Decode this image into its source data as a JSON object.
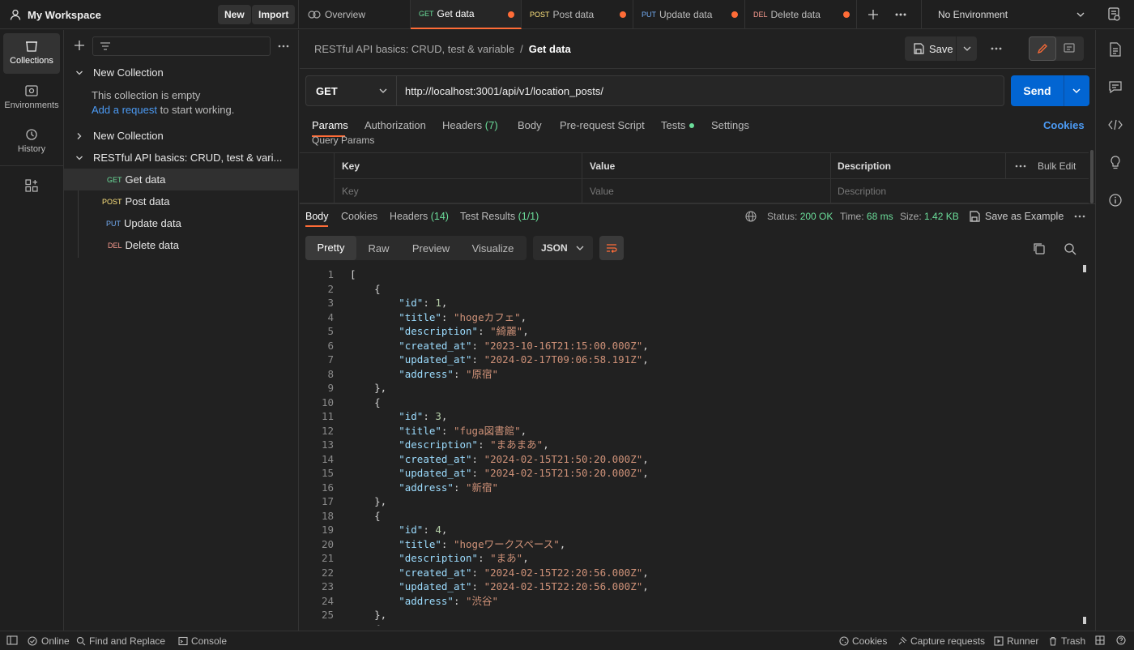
{
  "header": {
    "workspace_title": "My Workspace",
    "new_label": "New",
    "import_label": "Import",
    "tabs": [
      {
        "method": "",
        "label": "Overview"
      },
      {
        "method": "GET",
        "label": "Get data"
      },
      {
        "method": "POST",
        "label": "Post data"
      },
      {
        "method": "PUT",
        "label": "Update data"
      },
      {
        "method": "DEL",
        "label": "Delete data"
      }
    ],
    "environment": "No Environment"
  },
  "rail": {
    "items": [
      {
        "label": "Collections",
        "icon": "collections-icon"
      },
      {
        "label": "Environments",
        "icon": "environments-icon"
      },
      {
        "label": "History",
        "icon": "history-icon"
      },
      {
        "label": "",
        "icon": "add-panel-icon"
      }
    ]
  },
  "sidebar": {
    "collections": [
      {
        "name": "New Collection",
        "expanded": true
      },
      {
        "name": "New Collection",
        "expanded": false
      },
      {
        "name": "RESTful API basics: CRUD, test & vari...",
        "expanded": true
      }
    ],
    "empty_text": "This collection is empty",
    "add_request_link": "Add a request",
    "add_request_suffix": " to start working.",
    "requests": [
      {
        "method": "GET",
        "label": "Get data"
      },
      {
        "method": "POST",
        "label": "Post data"
      },
      {
        "method": "PUT",
        "label": "Update data"
      },
      {
        "method": "DEL",
        "label": "Delete data"
      }
    ]
  },
  "request": {
    "breadcrumb_collection": "RESTful API basics: CRUD, test & variable",
    "breadcrumb_separator": "/",
    "breadcrumb_current": "Get data",
    "save_label": "Save",
    "method": "GET",
    "url": "http://localhost:3001/api/v1/location_posts/",
    "send_label": "Send",
    "tabs": {
      "params": "Params",
      "authorization": "Authorization",
      "headers": "Headers",
      "headers_count": "(7)",
      "body": "Body",
      "prerequest": "Pre-request Script",
      "tests": "Tests",
      "settings": "Settings",
      "cookies": "Cookies"
    },
    "query_params_title": "Query Params",
    "table": {
      "key_header": "Key",
      "value_header": "Value",
      "description_header": "Description",
      "bulk_edit": "Bulk Edit",
      "key_placeholder": "Key",
      "value_placeholder": "Value",
      "description_placeholder": "Description"
    }
  },
  "response": {
    "tabs": {
      "body": "Body",
      "cookies": "Cookies",
      "headers": "Headers",
      "headers_count": "(14)",
      "test_results": "Test Results",
      "test_results_count": "(1/1)"
    },
    "status_label": "Status:",
    "status_value": "200 OK",
    "time_label": "Time:",
    "time_value": "68 ms",
    "size_label": "Size:",
    "size_value": "1.42 KB",
    "save_example": "Save as Example",
    "view_modes": [
      "Pretty",
      "Raw",
      "Preview",
      "Visualize"
    ],
    "format": "JSON",
    "code_lines": [
      "[",
      "    {",
      "        \"id\": 1,",
      "        \"title\": \"hogeカフェ\",",
      "        \"description\": \"綺麗\",",
      "        \"created_at\": \"2023-10-16T21:15:00.000Z\",",
      "        \"updated_at\": \"2024-02-17T09:06:58.191Z\",",
      "        \"address\": \"原宿\"",
      "    },",
      "    {",
      "        \"id\": 3,",
      "        \"title\": \"fuga図書館\",",
      "        \"description\": \"まあまあ\",",
      "        \"created_at\": \"2024-02-15T21:50:20.000Z\",",
      "        \"updated_at\": \"2024-02-15T21:50:20.000Z\",",
      "        \"address\": \"新宿\"",
      "    },",
      "    {",
      "        \"id\": 4,",
      "        \"title\": \"hogeワークスペース\",",
      "        \"description\": \"まあ\",",
      "        \"created_at\": \"2024-02-15T22:20:56.000Z\",",
      "        \"updated_at\": \"2024-02-15T22:20:56.000Z\",",
      "        \"address\": \"渋谷\"",
      "    },",
      "    {"
    ]
  },
  "statusbar": {
    "online": "Online",
    "find_replace": "Find and Replace",
    "console": "Console",
    "cookies": "Cookies",
    "capture": "Capture requests",
    "runner": "Runner",
    "trash": "Trash"
  },
  "colors": {
    "accent": "#ff6c37",
    "send_blue": "#0265d2",
    "success_green": "#6bdd9a",
    "link_blue": "#4c9bf5"
  }
}
